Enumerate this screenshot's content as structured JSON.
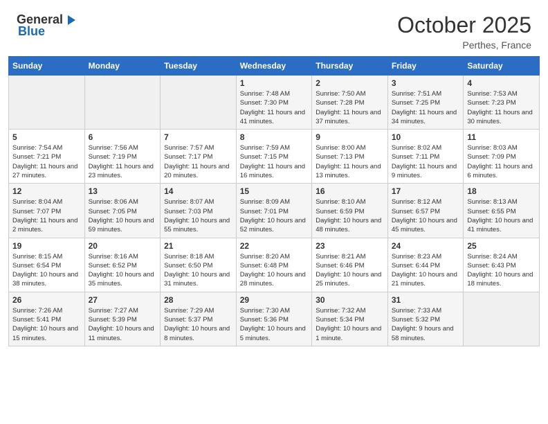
{
  "header": {
    "logo_general": "General",
    "logo_blue": "Blue",
    "month": "October 2025",
    "location": "Perthes, France"
  },
  "days_of_week": [
    "Sunday",
    "Monday",
    "Tuesday",
    "Wednesday",
    "Thursday",
    "Friday",
    "Saturday"
  ],
  "weeks": [
    [
      {
        "day": "",
        "info": ""
      },
      {
        "day": "",
        "info": ""
      },
      {
        "day": "",
        "info": ""
      },
      {
        "day": "1",
        "info": "Sunrise: 7:48 AM\nSunset: 7:30 PM\nDaylight: 11 hours and 41 minutes."
      },
      {
        "day": "2",
        "info": "Sunrise: 7:50 AM\nSunset: 7:28 PM\nDaylight: 11 hours and 37 minutes."
      },
      {
        "day": "3",
        "info": "Sunrise: 7:51 AM\nSunset: 7:25 PM\nDaylight: 11 hours and 34 minutes."
      },
      {
        "day": "4",
        "info": "Sunrise: 7:53 AM\nSunset: 7:23 PM\nDaylight: 11 hours and 30 minutes."
      }
    ],
    [
      {
        "day": "5",
        "info": "Sunrise: 7:54 AM\nSunset: 7:21 PM\nDaylight: 11 hours and 27 minutes."
      },
      {
        "day": "6",
        "info": "Sunrise: 7:56 AM\nSunset: 7:19 PM\nDaylight: 11 hours and 23 minutes."
      },
      {
        "day": "7",
        "info": "Sunrise: 7:57 AM\nSunset: 7:17 PM\nDaylight: 11 hours and 20 minutes."
      },
      {
        "day": "8",
        "info": "Sunrise: 7:59 AM\nSunset: 7:15 PM\nDaylight: 11 hours and 16 minutes."
      },
      {
        "day": "9",
        "info": "Sunrise: 8:00 AM\nSunset: 7:13 PM\nDaylight: 11 hours and 13 minutes."
      },
      {
        "day": "10",
        "info": "Sunrise: 8:02 AM\nSunset: 7:11 PM\nDaylight: 11 hours and 9 minutes."
      },
      {
        "day": "11",
        "info": "Sunrise: 8:03 AM\nSunset: 7:09 PM\nDaylight: 11 hours and 6 minutes."
      }
    ],
    [
      {
        "day": "12",
        "info": "Sunrise: 8:04 AM\nSunset: 7:07 PM\nDaylight: 11 hours and 2 minutes."
      },
      {
        "day": "13",
        "info": "Sunrise: 8:06 AM\nSunset: 7:05 PM\nDaylight: 10 hours and 59 minutes."
      },
      {
        "day": "14",
        "info": "Sunrise: 8:07 AM\nSunset: 7:03 PM\nDaylight: 10 hours and 55 minutes."
      },
      {
        "day": "15",
        "info": "Sunrise: 8:09 AM\nSunset: 7:01 PM\nDaylight: 10 hours and 52 minutes."
      },
      {
        "day": "16",
        "info": "Sunrise: 8:10 AM\nSunset: 6:59 PM\nDaylight: 10 hours and 48 minutes."
      },
      {
        "day": "17",
        "info": "Sunrise: 8:12 AM\nSunset: 6:57 PM\nDaylight: 10 hours and 45 minutes."
      },
      {
        "day": "18",
        "info": "Sunrise: 8:13 AM\nSunset: 6:55 PM\nDaylight: 10 hours and 41 minutes."
      }
    ],
    [
      {
        "day": "19",
        "info": "Sunrise: 8:15 AM\nSunset: 6:54 PM\nDaylight: 10 hours and 38 minutes."
      },
      {
        "day": "20",
        "info": "Sunrise: 8:16 AM\nSunset: 6:52 PM\nDaylight: 10 hours and 35 minutes."
      },
      {
        "day": "21",
        "info": "Sunrise: 8:18 AM\nSunset: 6:50 PM\nDaylight: 10 hours and 31 minutes."
      },
      {
        "day": "22",
        "info": "Sunrise: 8:20 AM\nSunset: 6:48 PM\nDaylight: 10 hours and 28 minutes."
      },
      {
        "day": "23",
        "info": "Sunrise: 8:21 AM\nSunset: 6:46 PM\nDaylight: 10 hours and 25 minutes."
      },
      {
        "day": "24",
        "info": "Sunrise: 8:23 AM\nSunset: 6:44 PM\nDaylight: 10 hours and 21 minutes."
      },
      {
        "day": "25",
        "info": "Sunrise: 8:24 AM\nSunset: 6:43 PM\nDaylight: 10 hours and 18 minutes."
      }
    ],
    [
      {
        "day": "26",
        "info": "Sunrise: 7:26 AM\nSunset: 5:41 PM\nDaylight: 10 hours and 15 minutes."
      },
      {
        "day": "27",
        "info": "Sunrise: 7:27 AM\nSunset: 5:39 PM\nDaylight: 10 hours and 11 minutes."
      },
      {
        "day": "28",
        "info": "Sunrise: 7:29 AM\nSunset: 5:37 PM\nDaylight: 10 hours and 8 minutes."
      },
      {
        "day": "29",
        "info": "Sunrise: 7:30 AM\nSunset: 5:36 PM\nDaylight: 10 hours and 5 minutes."
      },
      {
        "day": "30",
        "info": "Sunrise: 7:32 AM\nSunset: 5:34 PM\nDaylight: 10 hours and 1 minute."
      },
      {
        "day": "31",
        "info": "Sunrise: 7:33 AM\nSunset: 5:32 PM\nDaylight: 9 hours and 58 minutes."
      },
      {
        "day": "",
        "info": ""
      }
    ]
  ]
}
